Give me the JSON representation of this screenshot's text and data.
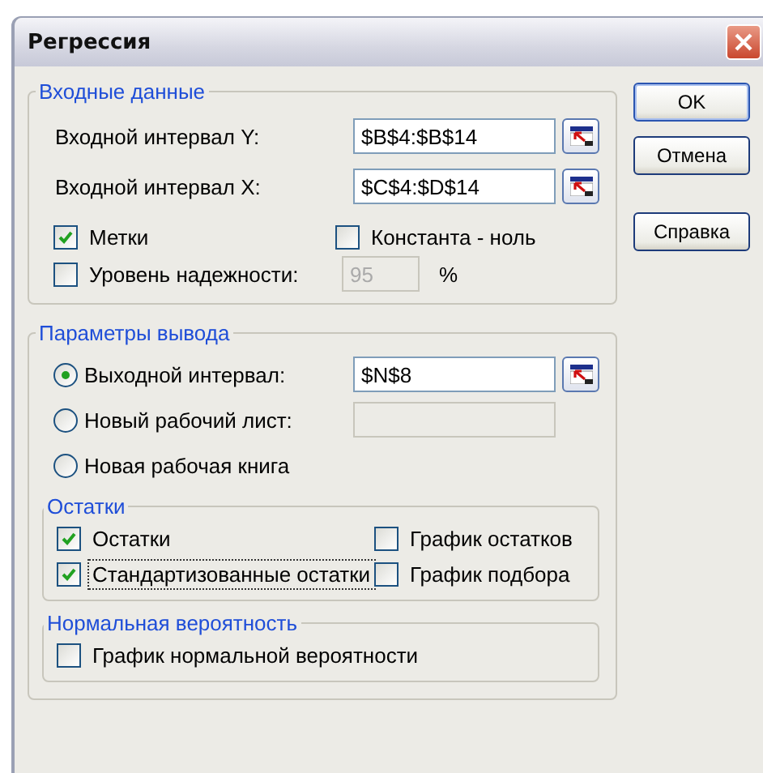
{
  "window": {
    "title": "Регрессия"
  },
  "input_data": {
    "title": "Входные данные",
    "fields": [
      {
        "label": "Входной интервал Y:",
        "value": "$B$4:$B$14"
      },
      {
        "label": "Входной интервал X:",
        "value": "$C$4:$D$14"
      }
    ],
    "options": [
      {
        "label": "Метки",
        "checked": true
      },
      {
        "label": "Константа - ноль",
        "checked": false
      }
    ],
    "confidence": {
      "label": "Уровень надежности:",
      "checked": false,
      "value": "95",
      "disabled": true,
      "unit": "%"
    }
  },
  "output": {
    "title": "Параметры вывода",
    "targets": [
      {
        "label": "Выходной интервал:",
        "selected": true,
        "kind": "field",
        "value": "$N$8",
        "disabled": false
      },
      {
        "label": "Новый рабочий лист:",
        "selected": false,
        "kind": "field",
        "disabled": true
      },
      {
        "label": "Новая рабочая книга",
        "selected": false,
        "kind": "plain"
      }
    ],
    "residuals": {
      "title": "Остатки",
      "options": [
        {
          "label": "Остатки",
          "checked": true,
          "focused": false
        },
        {
          "label": "График остатков",
          "checked": false,
          "focused": false
        },
        {
          "label": "Стандартизованные остатки",
          "checked": true,
          "focused": true
        },
        {
          "label": "График подбора",
          "checked": false,
          "focused": false
        }
      ]
    },
    "normal": {
      "title": "Нормальная вероятность",
      "options": [
        {
          "label": "График нормальной вероятности",
          "checked": false,
          "focused": false
        }
      ]
    }
  },
  "buttons": [
    {
      "label": "OK",
      "kind": "default"
    },
    {
      "label": "Отмена",
      "kind": "normal"
    },
    {
      "label": "Справка",
      "kind": "help"
    }
  ]
}
